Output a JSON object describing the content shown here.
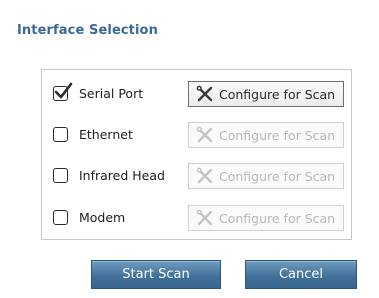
{
  "dialog": {
    "title": "Interface Selection"
  },
  "interfaces": [
    {
      "label": "Serial Port",
      "checked": true,
      "configure_label": "Configure for Scan",
      "configure_enabled": true
    },
    {
      "label": "Ethernet",
      "checked": false,
      "configure_label": "Configure for Scan",
      "configure_enabled": false
    },
    {
      "label": "Infrared Head",
      "checked": false,
      "configure_label": "Configure for Scan",
      "configure_enabled": false
    },
    {
      "label": "Modem",
      "checked": false,
      "configure_label": "Configure for Scan",
      "configure_enabled": false
    }
  ],
  "actions": {
    "start_label": "Start Scan",
    "cancel_label": "Cancel"
  },
  "icons": {
    "checkmark": "checkmark-icon",
    "configure": "wrench-screwdriver-icon"
  },
  "colors": {
    "title": "#3b6a9a",
    "primary_button": "#3f6f98",
    "disabled_text": "#b9b9b9"
  }
}
